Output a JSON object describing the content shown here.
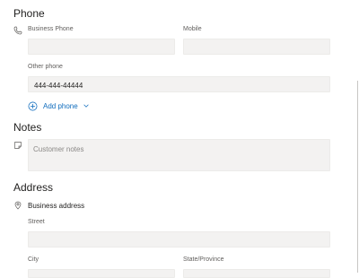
{
  "phone": {
    "title": "Phone",
    "business_label": "Business Phone",
    "business_value": "",
    "mobile_label": "Mobile",
    "mobile_value": "",
    "other_label": "Other phone",
    "other_value": "444-444-44444",
    "add_label": "Add phone"
  },
  "notes": {
    "title": "Notes",
    "placeholder": "Customer notes"
  },
  "address": {
    "title": "Address",
    "type_label": "Business address",
    "street_label": "Street",
    "city_label": "City",
    "state_label": "State/Province"
  },
  "icons": {
    "phone": "phone-icon",
    "add": "add-circle-icon",
    "chevron": "chevron-down-icon",
    "note": "note-icon",
    "location": "location-pin-icon"
  },
  "colors": {
    "accent": "#0f6cbd",
    "field_bg": "#f3f2f1"
  }
}
